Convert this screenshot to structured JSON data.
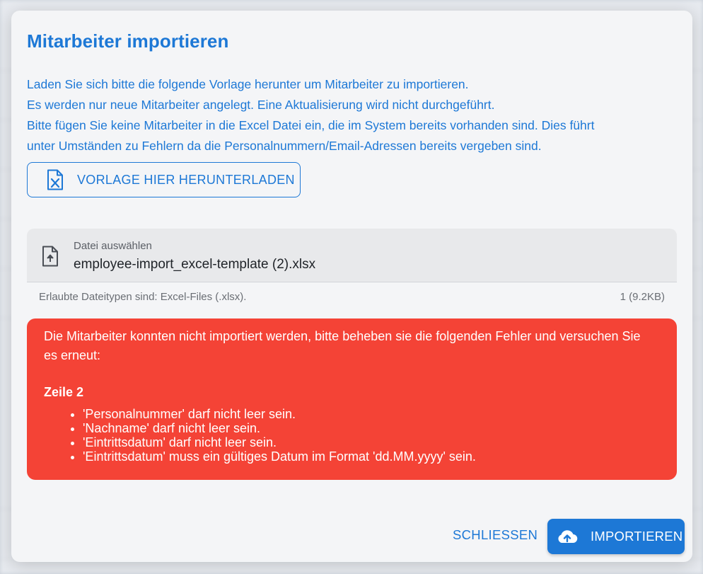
{
  "dialog": {
    "title": "Mitarbeiter importieren",
    "intro": [
      "Laden Sie sich bitte die folgende Vorlage herunter um Mitarbeiter zu importieren.",
      "Es werden nur neue Mitarbeiter angelegt. Eine Aktualisierung wird nicht durchgeführt.",
      "Bitte fügen Sie keine Mitarbeiter in die Excel Datei ein, die im System bereits vorhanden sind. Dies führt",
      "unter Umständen zu Fehlern da die Personalnummern/Email-Adressen bereits vergeben sind."
    ],
    "download_label": "VORLAGE HIER HERUNTERLADEN",
    "file": {
      "label": "Datei auswählen",
      "value": "employee-import_excel-template (2).xlsx",
      "hint": "Erlaubte Dateitypen sind: Excel-Files (.xlsx).",
      "count": "1 (9.2KB)"
    },
    "error": {
      "message": "Die Mitarbeiter konnten nicht importiert werden, bitte beheben sie die folgenden Fehler und versuchen Sie es erneut:",
      "row": "Zeile 2",
      "items": [
        "'Personalnummer' darf nicht leer sein.",
        "'Nachname' darf nicht leer sein.",
        "'Eintrittsdatum' darf nicht leer sein.",
        "'Eintrittsdatum' muss ein gültiges Datum im Format 'dd.MM.yyyy' sein."
      ]
    },
    "close_label": "SCHLIESSEN",
    "import_label": "IMPORTIEREN"
  },
  "colors": {
    "accent": "#1d78d6",
    "error": "#f44336",
    "surface": "#f4f5f7"
  },
  "icons": {
    "download": "excel-file-icon",
    "file": "file-upload-icon",
    "import": "cloud-upload-icon"
  }
}
